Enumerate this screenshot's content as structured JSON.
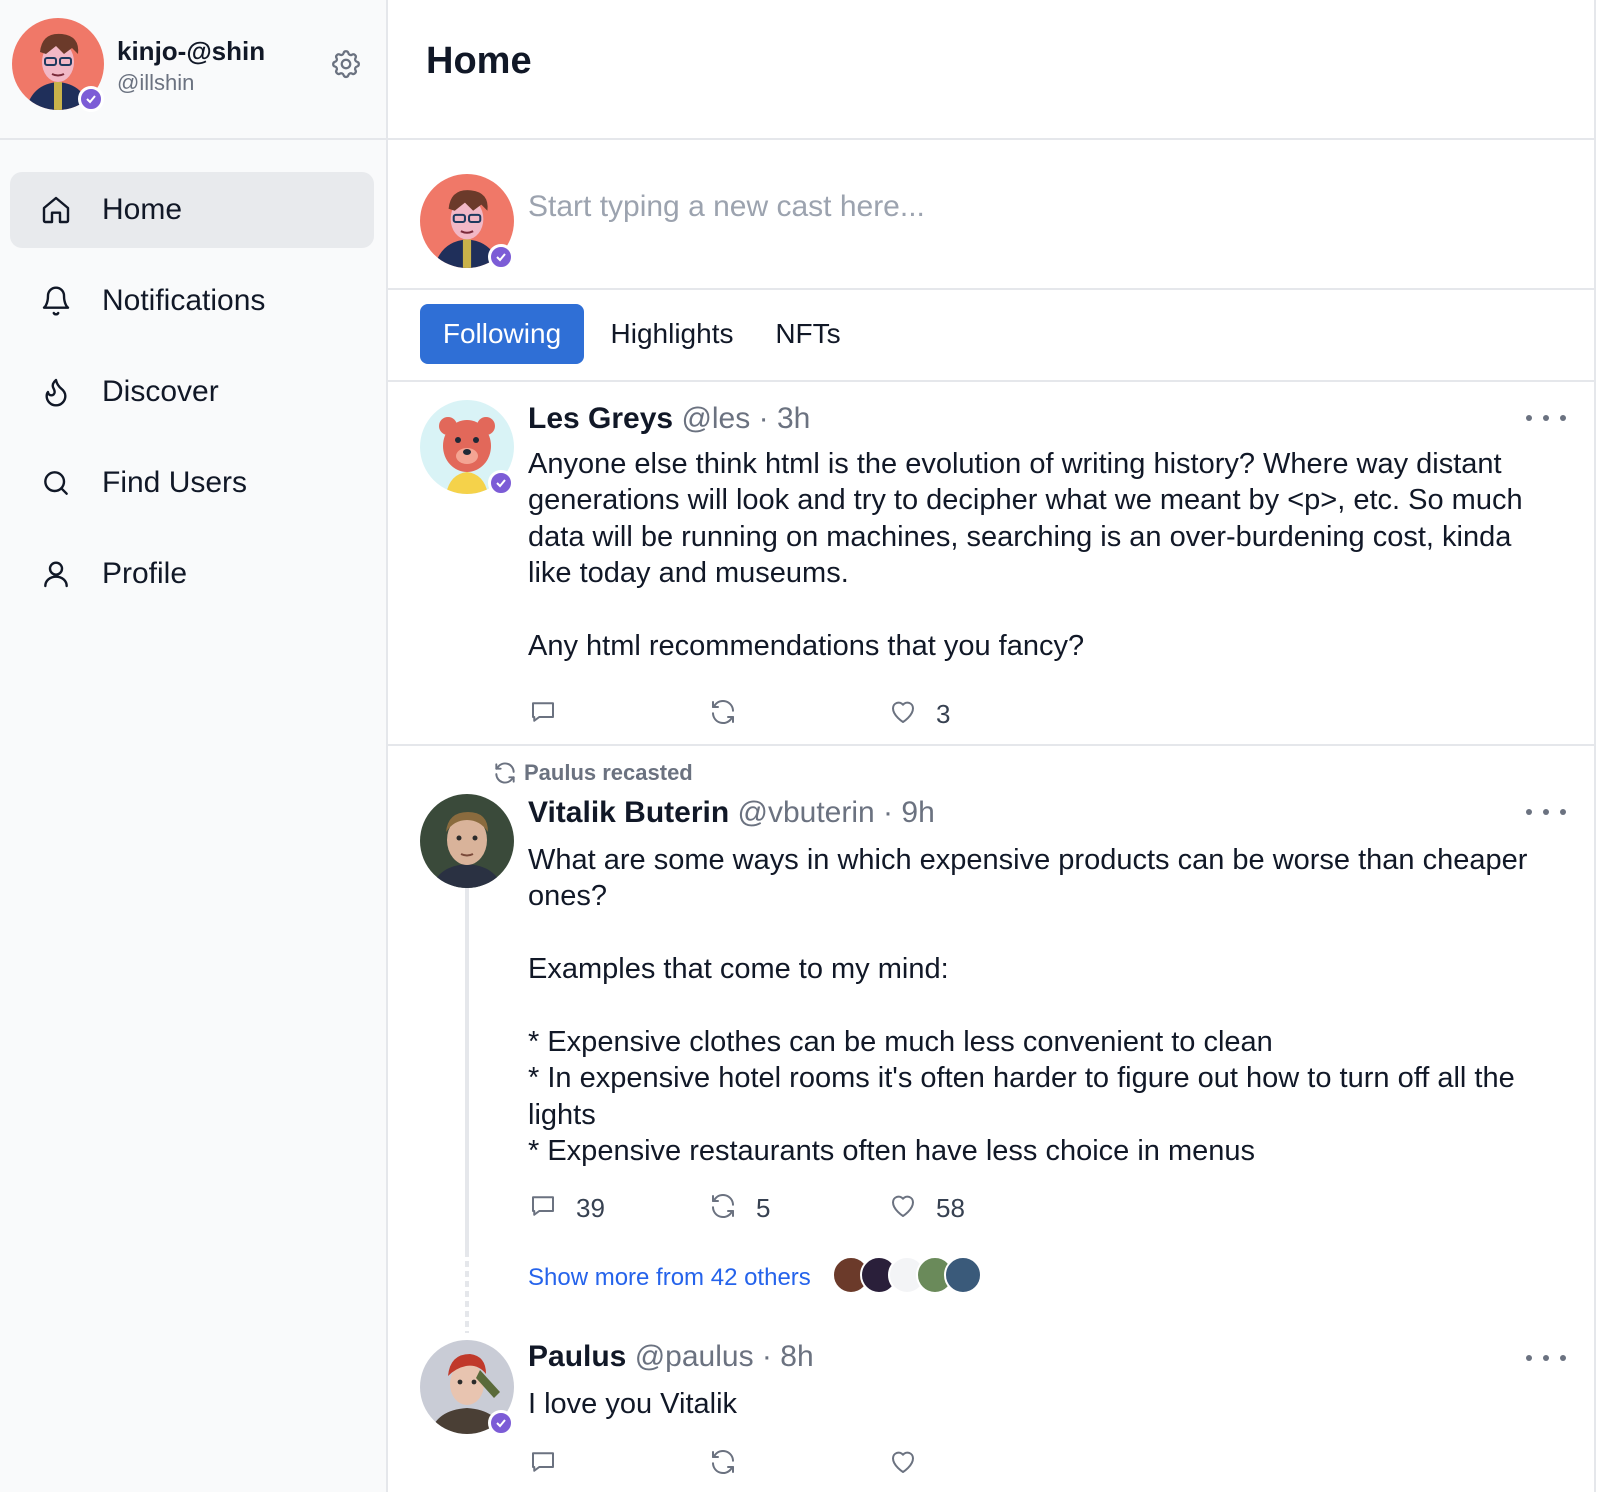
{
  "account": {
    "display_name": "kinjo-@shin",
    "handle": "@illshin"
  },
  "nav": {
    "items": [
      {
        "label": "Home",
        "icon": "home-icon",
        "active": true
      },
      {
        "label": "Notifications",
        "icon": "bell-icon",
        "active": false
      },
      {
        "label": "Discover",
        "icon": "flame-icon",
        "active": false
      },
      {
        "label": "Find Users",
        "icon": "search-icon",
        "active": false
      },
      {
        "label": "Profile",
        "icon": "user-icon",
        "active": false
      }
    ]
  },
  "header": {
    "title": "Home"
  },
  "composer": {
    "placeholder": "Start typing a new cast here..."
  },
  "tabs": [
    {
      "label": "Following",
      "active": true
    },
    {
      "label": "Highlights",
      "active": false
    },
    {
      "label": "NFTs",
      "active": false
    }
  ],
  "colors": {
    "accent": "#2f6fd6",
    "link": "#2563eb",
    "verified_badge": "#7c5cd6"
  },
  "casts": [
    {
      "name": "Les Greys",
      "handle": "@les",
      "age": "3h",
      "text": "Anyone else think html is the evolution of writing history? Where way distant generations will look and try to decipher what we meant by <p>, etc. So much data will be running on machines, searching is an over-burdening cost, kinda like today and museums.\n\nAny html recommendations that you fancy?",
      "replies": "",
      "recasts": "",
      "likes": "3"
    },
    {
      "recast_by": "Paulus recasted",
      "name": "Vitalik Buterin",
      "handle": "@vbuterin",
      "age": "9h",
      "text": "What are some ways in which expensive products can be worse than cheaper ones?\n\nExamples that come to my mind:\n\n* Expensive clothes can be much less convenient to clean\n* In expensive hotel rooms it's often harder to figure out how to turn off all the lights\n* Expensive restaurants often have less choice in menus",
      "replies": "39",
      "recasts": "5",
      "likes": "58",
      "show_more": "Show more from 42 others"
    },
    {
      "name": "Paulus",
      "handle": "@paulus",
      "age": "8h",
      "text": "I love you Vitalik",
      "replies": "",
      "recasts": "",
      "likes": ""
    }
  ]
}
